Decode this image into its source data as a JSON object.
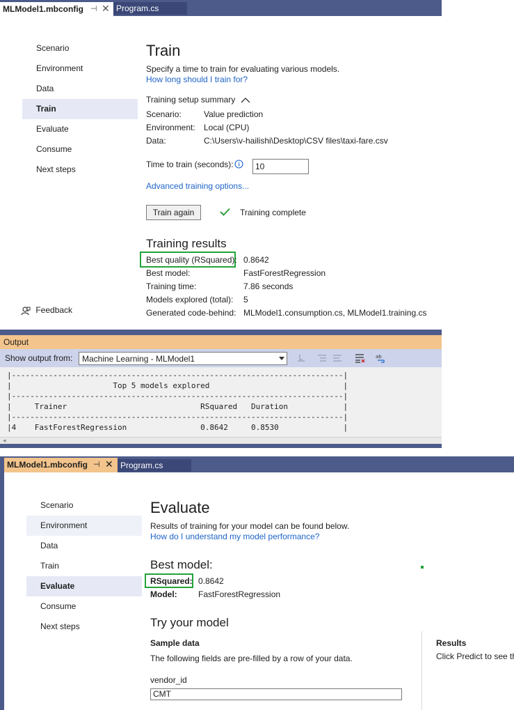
{
  "top_doc": {
    "tabs": [
      {
        "label": "MLModel1.mbconfig",
        "pin": "⊣",
        "close": "✕"
      },
      {
        "label": "Program.cs"
      }
    ],
    "nav": [
      "Scenario",
      "Environment",
      "Data",
      "Train",
      "Evaluate",
      "Consume",
      "Next steps"
    ],
    "selected_nav": "Train",
    "feedback_label": "Feedback",
    "title": "Train",
    "description": "Specify a time to train for evaluating various models.",
    "help_link": "How long should I train for?",
    "summary_label": "Training setup summary",
    "summary": [
      {
        "label": "Scenario:",
        "value": "Value prediction"
      },
      {
        "label": "Environment:",
        "value": "Local (CPU)"
      },
      {
        "label": "Data:",
        "value": "C:\\Users\\v-hailishi\\Desktop\\CSV files\\taxi-fare.csv"
      }
    ],
    "time_label": "Time to train (seconds):",
    "time_value": "10",
    "advanced_link": "Advanced training options...",
    "train_button": "Train again",
    "status": "Training complete",
    "results_title": "Training results",
    "results": [
      {
        "label": "Best quality (RSquared):",
        "value": "0.8642"
      },
      {
        "label": "Best model:",
        "value": "FastForestRegression"
      },
      {
        "label": "Training time:",
        "value": "7.86 seconds"
      },
      {
        "label": "Models explored (total):",
        "value": "5"
      },
      {
        "label": "Generated code-behind:",
        "value": "MLModel1.consumption.cs, MLModel1.training.cs"
      }
    ]
  },
  "output": {
    "title": "Output",
    "show_from_label": "Show output from:",
    "source": "Machine Learning - MLModel1",
    "console": [
      "|------------------------------------------------------------------------|",
      "|                      Top 5 models explored                             |",
      "|------------------------------------------------------------------------|",
      "|     Trainer                             RSquared   Duration            |",
      "|------------------------------------------------------------------------|",
      "|4    FastForestRegression                0.8642     0.8530              |"
    ]
  },
  "bottom_doc": {
    "tabs": [
      {
        "label": "MLModel1.mbconfig",
        "pin": "⊣",
        "close": "✕"
      },
      {
        "label": "Program.cs"
      }
    ],
    "nav": [
      "Scenario",
      "Environment",
      "Data",
      "Train",
      "Evaluate",
      "Consume",
      "Next steps"
    ],
    "selected_nav": "Evaluate",
    "title": "Evaluate",
    "description": "Results of training for your model can be found below.",
    "help_link": "How do I understand my model performance?",
    "best_model_title": "Best model:",
    "rsquared_label": "RSquared:",
    "rsquared_value": "0.8642",
    "model_label": "Model:",
    "model_value": "FastForestRegression",
    "try_title": "Try your model",
    "sample_title": "Sample data",
    "sample_desc": "The following fields are pre-filled by a row of your data.",
    "field_label": "vendor_id",
    "field_value": "CMT",
    "results_title": "Results",
    "results_desc": "Click Predict to see th"
  },
  "colors": {
    "accent": "#4d5b8a",
    "output_header": "#f3c48c",
    "highlight_box": "#22a33b",
    "link": "#1e64c8",
    "check": "#2e9a3a"
  },
  "icons": {
    "feedback": "feedback-icon",
    "info": "info-icon",
    "check": "check-icon",
    "collapse": "chevron-up-icon"
  }
}
